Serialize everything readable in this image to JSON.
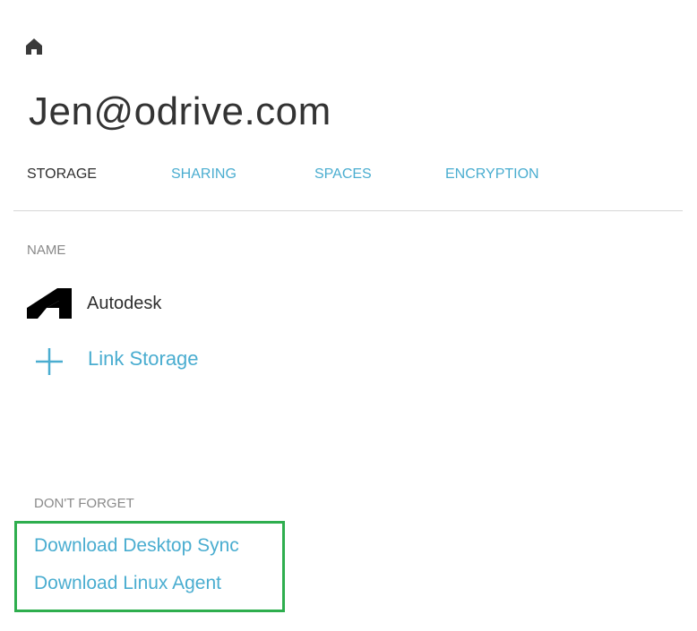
{
  "header": {
    "home_icon": "home-icon",
    "account_title": "Jen@odrive.com"
  },
  "tabs": [
    {
      "label": "STORAGE",
      "active": true
    },
    {
      "label": "SHARING",
      "active": false
    },
    {
      "label": "SPACES",
      "active": false
    },
    {
      "label": "ENCRYPTION",
      "active": false
    }
  ],
  "storage_list": {
    "column_header": "NAME",
    "items": [
      {
        "name": "Autodesk",
        "icon": "autodesk-logo"
      }
    ],
    "link_storage_label": "Link Storage",
    "link_storage_icon": "plus-icon"
  },
  "dont_forget": {
    "heading": "DON'T FORGET",
    "links": [
      {
        "label": "Download Desktop Sync"
      },
      {
        "label": "Download Linux Agent"
      }
    ]
  },
  "colors": {
    "accent": "#4aadd0",
    "text_dark": "#2f2f2f",
    "muted": "#888888",
    "highlight_border": "#2eae4e",
    "divider": "#d6d6d6"
  }
}
